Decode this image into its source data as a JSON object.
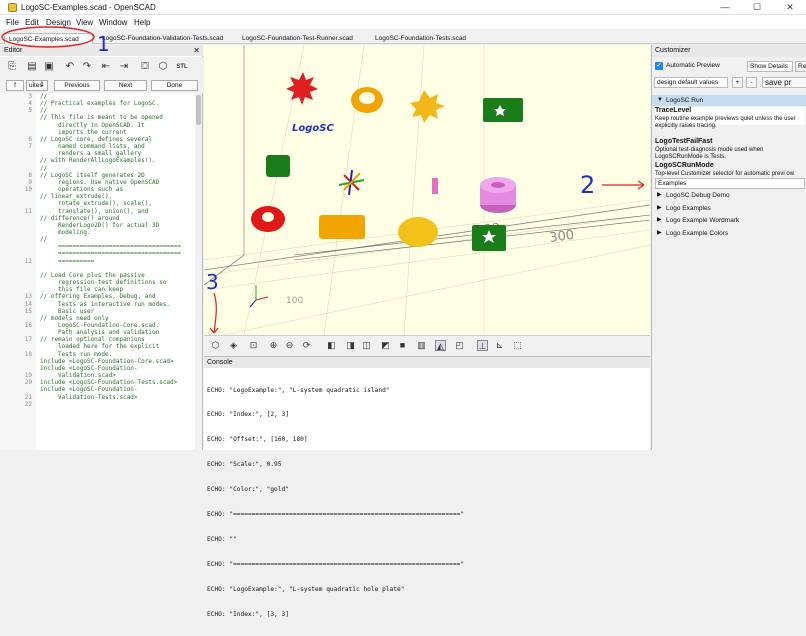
{
  "window": {
    "title": "LogoSC-Examples.scad - OpenSCAD",
    "minimize": "—",
    "maximize": "☐",
    "close": "✕"
  },
  "menu": [
    "File",
    "Edit",
    "Design",
    "View",
    "Window",
    "Help"
  ],
  "tabs": [
    "LogoSC-Examples.scad",
    "LogoSC-Foundation-Validation-Tests.scad",
    "LogoSC-Foundation-Test-Runner.scad",
    "LogoSC-Foundation-Tests.scad"
  ],
  "tab_close": "x",
  "editor": {
    "title": "Editor",
    "close": "✕",
    "find_mode": "f",
    "find_value": "uites",
    "find_number": "1",
    "previous": "Previous",
    "next": "Next",
    "done": "Done",
    "line_numbers": "3\n4\n5\n\n\n\n6\n7\n\n\n\n8\n9\n10\n\n\n11\n\n\n\n\n\n\n12\n\n\n\n\n13\n14\n15\n\n16\n\n17\n\n18\n\n\n19\n20\n\n21\n22\n\n",
    "code": "//\n// Practical examples for LogoSC.\n//\n// This file is meant to be opened\n     directly in OpenSCAD. It\n     imports the current\n// LogoSC core, defines several\n     named command lists, and\n     renders a small gallery\n// with RenderAllLogoExamples().\n//\n// LogoSC itself generates 2D\n     regions. Use native OpenSCAD\n     operations such as\n// linear_extrude(),\n     rotate_extrude(), scale(),\n     translate(), union(), and\n// difference() around\n     RenderLogo2D() for actual 3D\n     modeling.\n//\n     ==================================\n     ==================================\n     ==========\n\n// Load Core plus the passive\n     regression-test definitions so\n     this file can keep\n// offering Examples, Debug, and\n     Tests as interactive run modes.\n     Basic user\n// models need only\n     LogoSC-Foundation-Core.scad.\n     Path analysis and validation\n// remain optional companions\n     loaded here for the explicit\n     Tests run mode.\ninclude <LogoSC-Foundation-Core.scad>\ninclude <LogoSC-Foundation-\n     Validation.scad>\ninclude <LogoSC-Foundation-Tests.scad>\ninclude <LogoSC-Foundation-\n     Validation-Tests.scad>"
  },
  "viewport": {
    "logo_text": "LogoSC",
    "axis_labels": [
      "100",
      "200",
      "300",
      "100"
    ]
  },
  "console": {
    "title": "Console",
    "lines": [
      "ECHO: \"LogoExample:\", \"L-system quadratic island\"",
      "ECHO: \"Index:\", [2, 3]",
      "ECHO: \"Offset:\", [160, 180]",
      "ECHO: \"Scale:\", 0.95",
      "ECHO: \"Color:\", \"gold\"",
      "ECHO: \"=============================================================\"",
      "ECHO: \"\"",
      "ECHO: \"=============================================================\"",
      "ECHO: \"LogoExample:\", \"L-system quadratic hole plate\"",
      "ECHO: \"Index:\", [3, 3]"
    ]
  },
  "customizer": {
    "title": "Customizer",
    "automatic_preview": "Automatic Preview",
    "show_details": "Show Details",
    "reset": "Rese",
    "preset": "design default values",
    "plus": "+",
    "minus": "-",
    "save": "save pr",
    "section_open": "LogoSC Run",
    "param1_name": "TraceLevel",
    "param1_desc": "Keep routine example previews quiet unless the user explicitly raises tracing.",
    "param2_name": "LogoTestFailFast",
    "param2_desc": "Optional test-diagnosis mode used when LogoSCRunMode is Tests.",
    "param3_name": "LogoSCRunMode",
    "param3_desc": "Top-level Customizer selector for automatic previ ow",
    "param3_value": "Examples",
    "sections": [
      "LogoSC Debug Demo",
      "Logo Examples",
      "Logo Example Wordmark",
      "Logo Example Colors"
    ]
  },
  "annotations": {
    "n1": "1",
    "n2": "2",
    "n3": "3"
  },
  "colors": {
    "red_note": "#e02020",
    "blue_note": "#2030c0",
    "viewport_bg": "#ffffe5",
    "selection": "#1e88e5"
  }
}
